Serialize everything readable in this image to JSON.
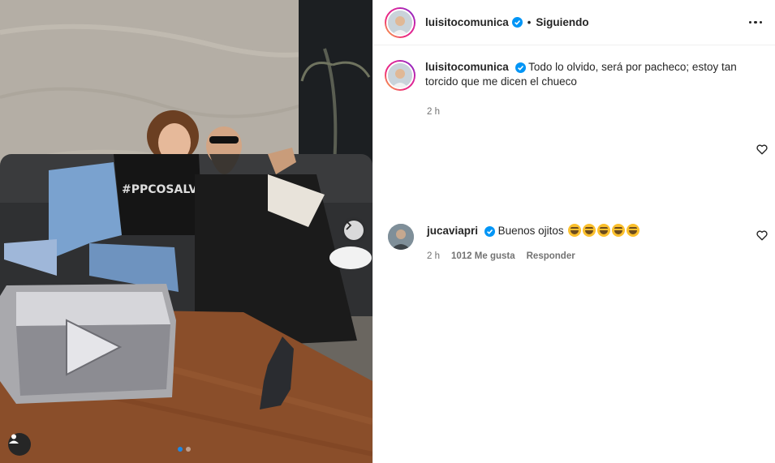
{
  "header": {
    "username": "luisitocomunica",
    "separator": "•",
    "follow_status": "Siguiendo"
  },
  "caption": {
    "username": "luisitocomunica",
    "text": "Todo lo olvido, será por pacheco; estoy tan torcido que me dicen el chueco",
    "time": "2 h"
  },
  "comments": [
    {
      "username": "jucaviapri",
      "text": "Buenos ojitos",
      "emoji_count": 5,
      "time": "2 h",
      "likes": "1012 Me gusta",
      "reply": "Responder"
    }
  ],
  "carousel": {
    "total": 2,
    "current": 1
  },
  "icons": {
    "verified": "verified-badge-icon",
    "more": "more-options-icon",
    "heart": "heart-outline-icon",
    "next": "chevron-right-icon",
    "tag": "user-tag-icon"
  },
  "colors": {
    "verified": "#0095f6",
    "carousel_active": "#1e88e5"
  }
}
